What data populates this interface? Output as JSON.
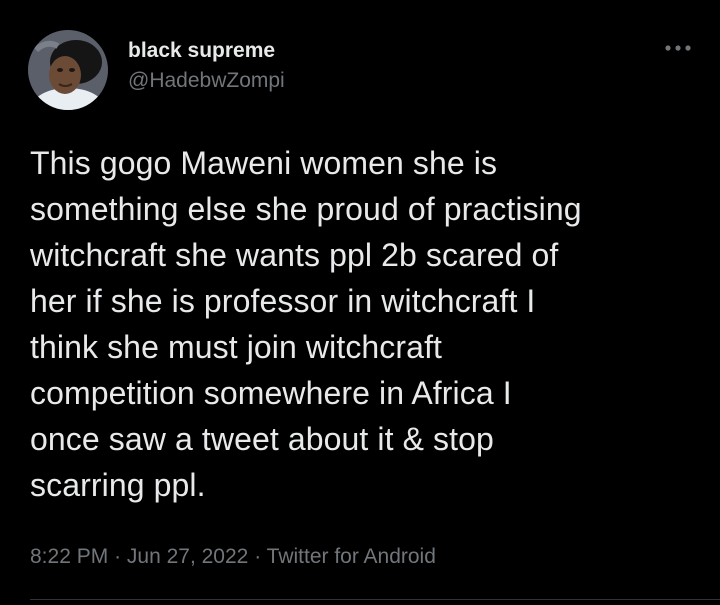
{
  "author": {
    "display_name": "black supreme",
    "handle": "@HadebwZompi"
  },
  "menu": {
    "icon": "more-horizontal-icon"
  },
  "tweet": {
    "lines": [
      "This gogo Maweni women she is",
      "something else she proud of practising",
      "witchcraft she wants ppl 2b scared of",
      "her if she is professor in witchcraft I",
      "think she must join witchcraft",
      "competition somewhere in Africa I",
      "once saw a tweet about it & stop",
      "scarring ppl."
    ]
  },
  "meta": {
    "time": "8:22 PM",
    "separator": "·",
    "date": "Jun 27, 2022",
    "source": "Twitter for Android"
  },
  "colors": {
    "background": "#000000",
    "text": "#e7e9ea",
    "secondary_text": "#71767b",
    "divider": "#2f3336"
  }
}
